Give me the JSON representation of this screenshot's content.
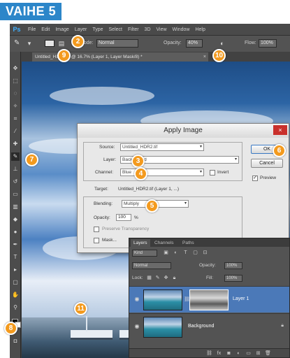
{
  "step_title": "VAIHE 5",
  "app": {
    "logo": "Ps",
    "menu": [
      "File",
      "Edit",
      "Image",
      "Layer",
      "Type",
      "Select",
      "Filter",
      "3D",
      "View",
      "Window",
      "Help"
    ]
  },
  "options_bar": {
    "tool_icon": "brush-icon",
    "mode_label": "Mode:",
    "mode_value": "Normal",
    "opacity_label": "Opacity:",
    "opacity_value": "40%",
    "flow_label": "Flow:",
    "flow_value": "100%"
  },
  "document_tab": {
    "title": "Untitled_HDR2.tif @ 16.7% (Layer 1, Layer Mask/8) *",
    "close": "×"
  },
  "apply_image": {
    "title": "Apply Image",
    "close": "×",
    "source_label": "Source:",
    "source_value": "Untitled_HDR2.tif",
    "layer_label": "Layer:",
    "layer_value": "Background",
    "channel_label": "Channel:",
    "channel_value": "Blue",
    "invert_label": "Invert",
    "invert_checked": false,
    "target_label": "Target:",
    "target_value": "Untitled_HDR2.tif (Layer 1, ...)",
    "blending_label": "Blending:",
    "blending_value": "Multiply",
    "opacity_label": "Opacity:",
    "opacity_value": "100",
    "opacity_unit": "%",
    "preserve_label": "Preserve Transparency",
    "mask_label": "Mask...",
    "ok_label": "OK",
    "cancel_label": "Cancel",
    "preview_label": "Preview",
    "preview_checked": true
  },
  "layers_panel": {
    "tabs": [
      "Layers",
      "Channels",
      "Paths"
    ],
    "kind_label": "Kind",
    "blend_mode": "Normal",
    "opacity_label": "Opacity:",
    "opacity_value": "100%",
    "lock_label": "Lock:",
    "fill_label": "Fill:",
    "fill_value": "100%",
    "layers": [
      {
        "name": "Layer 1",
        "selected": true,
        "has_mask": true
      },
      {
        "name": "Background",
        "selected": false,
        "has_mask": false
      }
    ]
  },
  "callouts": [
    "2",
    "3",
    "4",
    "5",
    "6",
    "7",
    "8",
    "9",
    "10",
    "11"
  ],
  "colors": {
    "step_banner": "#2c86c9",
    "callout": "#f39a1e",
    "selected_layer": "#4b79b8"
  }
}
